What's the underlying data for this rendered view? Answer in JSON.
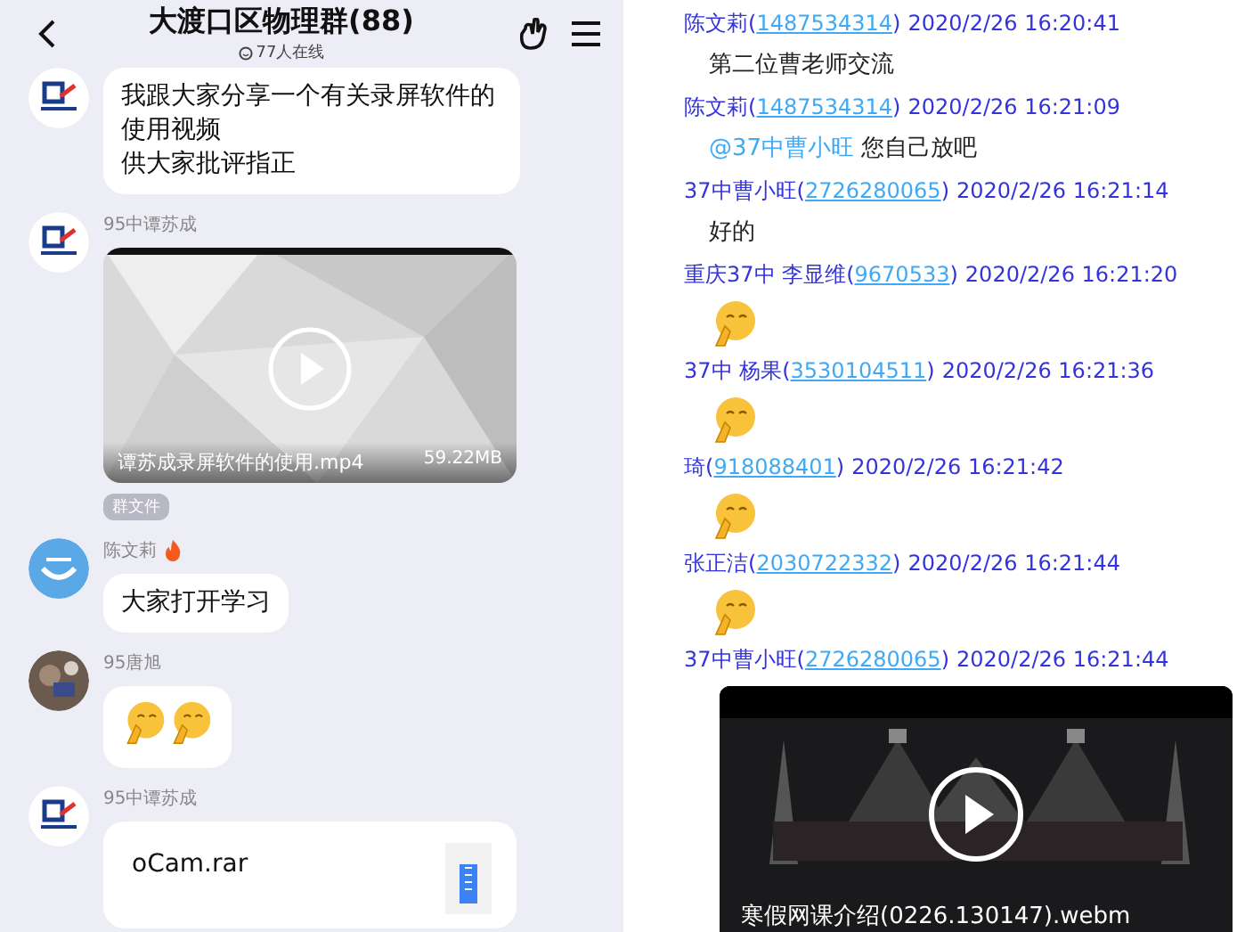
{
  "group_chat": {
    "title": "大渡口区物理群(88)",
    "online": "77人在线",
    "messages": [
      {
        "kind": "text",
        "avatar": {
          "kind": "logo"
        },
        "lines": [
          "我跟大家分享一个有关录屏软件的使用视频",
          "供大家批评指正"
        ]
      },
      {
        "kind": "video",
        "avatar": {
          "kind": "logo"
        },
        "sender": "95中谭苏成",
        "file_name": "谭苏成录屏软件的使用.mp4",
        "size": "59.22MB",
        "tag": "群文件"
      },
      {
        "kind": "text",
        "avatar": {
          "kind": "smile"
        },
        "sender": "陈文莉",
        "flame": true,
        "lines": [
          "大家打开学习"
        ]
      },
      {
        "kind": "emoji",
        "sender": "95唐旭",
        "emojis": [
          {
            "kind": "pray"
          },
          {
            "kind": "pray"
          }
        ]
      },
      {
        "kind": "file",
        "avatar": {
          "kind": "logo"
        },
        "sender": "95中谭苏成",
        "file_name": "oCam.rar"
      }
    ]
  },
  "chat_log": [
    {
      "sender": "陈文莉",
      "qq": "(1487534314)",
      "time": "2020/2/26 16:20:41",
      "content": {
        "kind": "text",
        "text": "第二位曹老师交流"
      }
    },
    {
      "sender": "陈文莉",
      "qq": "(1487534314)",
      "time": "2020/2/26 16:21:09",
      "content": {
        "kind": "text",
        "mention": "@37中曹小旺",
        "text": "您自己放吧"
      }
    },
    {
      "sender": "37中曹小旺",
      "qq": "(2726280065)",
      "time": "2020/2/26 16:21:14",
      "content": {
        "kind": "text",
        "text": "好的"
      }
    },
    {
      "sender": "重庆37中 李显维",
      "qq": "(9670533)",
      "time": "2020/2/26 16:21:20",
      "content": {
        "kind": "emoji"
      }
    },
    {
      "sender": "37中 杨果",
      "qq": "(3530104511)",
      "time": "2020/2/26 16:21:36",
      "content": {
        "kind": "emoji"
      }
    },
    {
      "sender": "琦",
      "qq": "(918088401)",
      "time": "2020/2/26 16:21:42",
      "content": {
        "kind": "emoji"
      }
    },
    {
      "sender": "张正洁",
      "qq": "(2030722332)",
      "time": "2020/2/26 16:21:44",
      "content": {
        "kind": "emoji"
      }
    },
    {
      "sender": "37中曹小旺",
      "qq": "(2726280065)",
      "time": "2020/2/26 16:21:44",
      "content": {
        "kind": "video",
        "file_name": "寒假网课介绍(0226.130147).webm"
      }
    }
  ]
}
